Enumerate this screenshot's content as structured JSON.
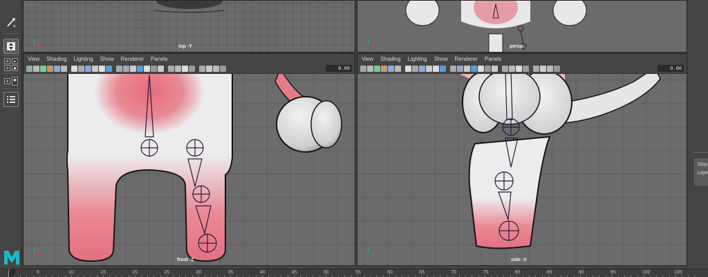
{
  "menus": [
    "View",
    "Shading",
    "Lighting",
    "Show",
    "Renderer",
    "Panels"
  ],
  "viewports": {
    "top": {
      "label": "top -Y"
    },
    "persp": {
      "label": "persp"
    },
    "front": {
      "label": "front -Z",
      "value": "0.00"
    },
    "side": {
      "label": "side -X",
      "value": "0.00"
    }
  },
  "right_panel": {
    "tab1": "Disp",
    "tab2": "Laye"
  },
  "timeline": {
    "ticks": [
      "5",
      "10",
      "15",
      "20",
      "25",
      "30",
      "35",
      "40",
      "45",
      "50",
      "55",
      "60",
      "65",
      "70",
      "75",
      "80",
      "85",
      "90",
      "95",
      "100",
      "105"
    ]
  },
  "colors": {
    "bg": "#444444",
    "viewport": "#6b6b6b",
    "grid": "#5d5d5d",
    "skin": "#e6e6e6",
    "pink": "#e87a86",
    "joint": "#2a1a3a",
    "selected": "#3a7fd6"
  },
  "icons": [
    "select-tool-icon",
    "move-tool-icon",
    "layout-icon",
    "outliner-icon",
    "maya-logo"
  ]
}
